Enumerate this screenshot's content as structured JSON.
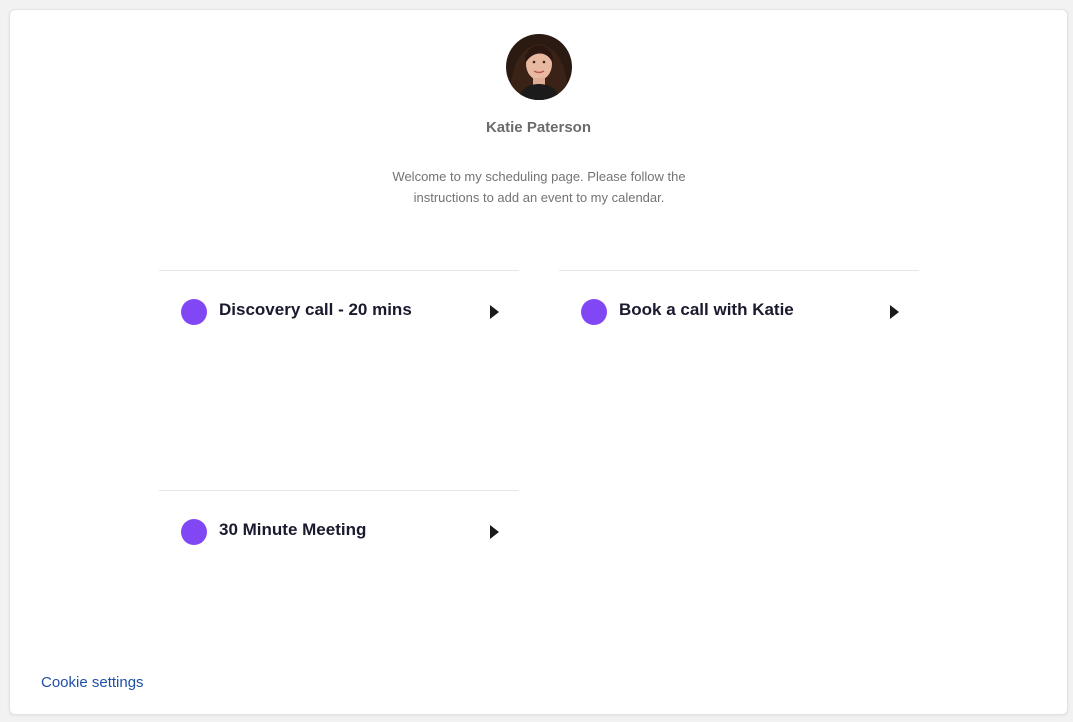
{
  "profile": {
    "name": "Katie Paterson",
    "welcome": "Welcome to my scheduling page. Please follow the instructions to add an event to my calendar."
  },
  "events": [
    {
      "label": "Discovery call - 20 mins",
      "color": "#8247f5",
      "icon": "caret-right-icon"
    },
    {
      "label": "Book a call with Katie",
      "color": "#8247f5",
      "icon": "caret-right-icon"
    },
    {
      "label": "30 Minute Meeting",
      "color": "#8247f5",
      "icon": "caret-right-icon"
    }
  ],
  "footer": {
    "cookie_label": "Cookie settings"
  },
  "colors": {
    "accent_dot": "#8247f5",
    "link": "#1f4fa8",
    "heading": "#1a1a2e"
  }
}
